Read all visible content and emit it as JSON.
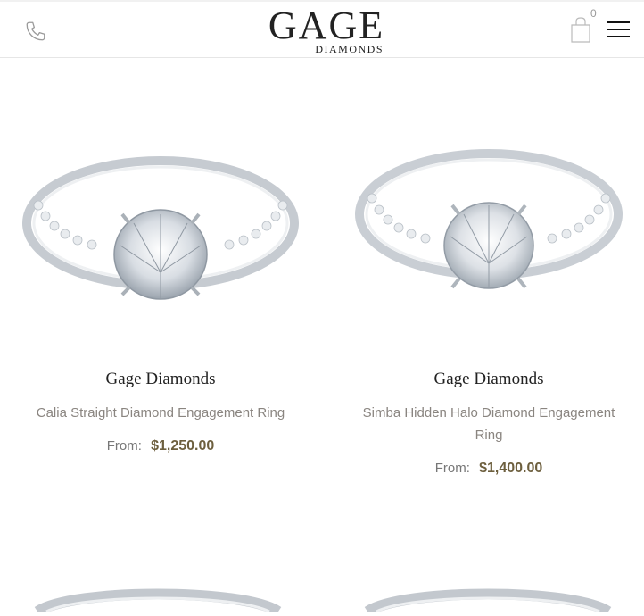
{
  "header": {
    "logo_main": "GAGE",
    "logo_sub": "DIAMONDS",
    "cart_count": "0",
    "icons": [
      "phone-icon",
      "cart-icon",
      "menu-icon"
    ]
  },
  "products": [
    {
      "brand": "Gage Diamonds",
      "name": "Calia Straight Diamond Engagement Ring",
      "price_prefix": "From:",
      "price": "$1,250.00"
    },
    {
      "brand": "Gage Diamonds",
      "name": "Simba Hidden Halo Diamond Engagement Ring",
      "price_prefix": "From:",
      "price": "$1,400.00"
    }
  ],
  "colors": {
    "accent_price": "#6d5f3e",
    "muted_text": "#8a8580"
  }
}
